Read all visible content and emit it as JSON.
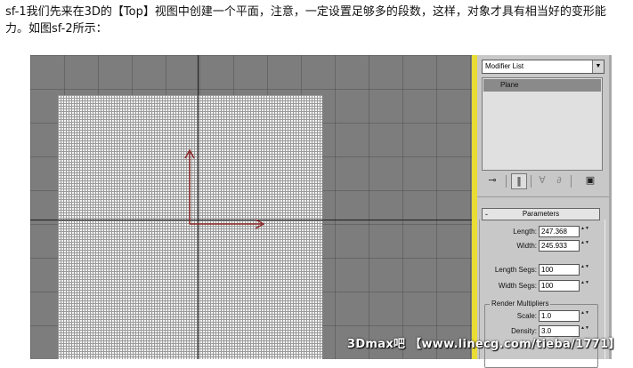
{
  "intro_text": "sf-1我们先来在3D的【Top】视图中创建一个平面，注意，一定设置足够多的段数，这样，对象才具有相当好的变形能力。如图sf-2所示：",
  "modifier_list": {
    "label": "Modifier List",
    "dropdown_glyph": "▼"
  },
  "stack": {
    "item": "Plane"
  },
  "toolbar_icons": [
    "pin-stack-icon",
    "show-end-result-icon",
    "make-unique-icon",
    "remove-modifier-icon",
    "configure-sets-icon"
  ],
  "toolbar_glyphs": {
    "pin": "⊸",
    "end_result": "‖",
    "unique": "∀",
    "remove": "∂",
    "configure": "▣"
  },
  "rollout": {
    "collapse_glyph": "-",
    "title": "Parameters",
    "length_label": "Length:",
    "length_value": "247.368",
    "width_label": "Width:",
    "width_value": "245.933",
    "length_segs_label": "Length Segs:",
    "length_segs_value": "100",
    "width_segs_label": "Width Segs:",
    "width_segs_value": "100",
    "render_group_title": "Render Multipliers",
    "scale_label": "Scale:",
    "scale_value": "1.0",
    "density_label": "Density:",
    "density_value": "3.0",
    "spinner_glyph": "▲▼"
  },
  "watermark": "3Dmax吧 【www.linecg.com/tieba/1771】",
  "colors": {
    "viewport_bg": "#7d7d7d",
    "plane": "#f4f4f4",
    "panel_border": "#e9dd35",
    "gizmo": "#8b2a2a"
  }
}
